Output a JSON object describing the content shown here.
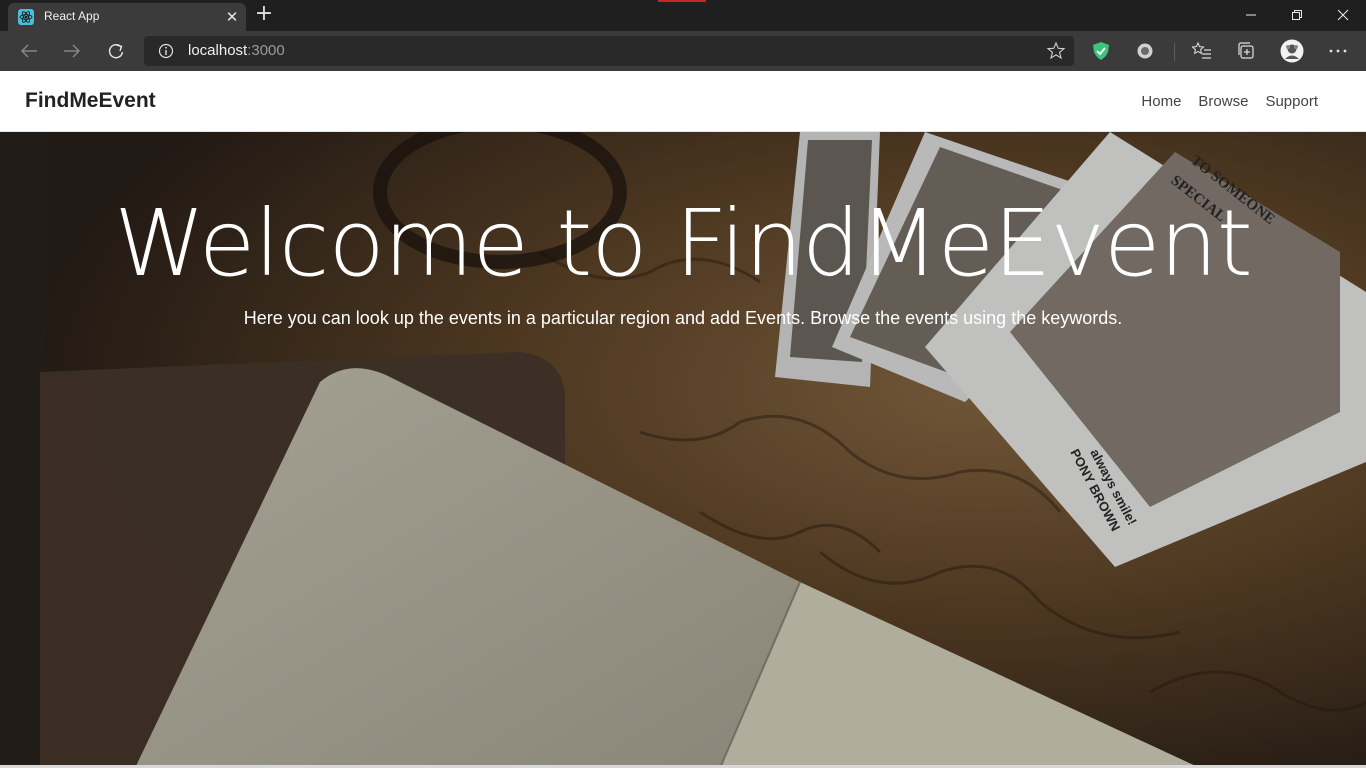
{
  "browser": {
    "tab_title": "React App",
    "address_host": "localhost",
    "address_port": ":3000"
  },
  "navbar": {
    "brand": "FindMeEvent",
    "links": [
      "Home",
      "Browse",
      "Support"
    ]
  },
  "hero": {
    "title": "Welcome to FindMeEvent",
    "subtitle": "Here you can look up the events in a particular region and add Events. Browse the events using the keywords.",
    "postcard_texts": [
      "TO SOMEONE SPECIAL",
      "always smile!",
      "PONY BROWN"
    ]
  },
  "colors": {
    "tab_bg": "#3b3b3b",
    "toolbar_bg": "#3b3b3b",
    "shield_green": "#3cc47c",
    "hero_tint": "#5a3f25"
  }
}
